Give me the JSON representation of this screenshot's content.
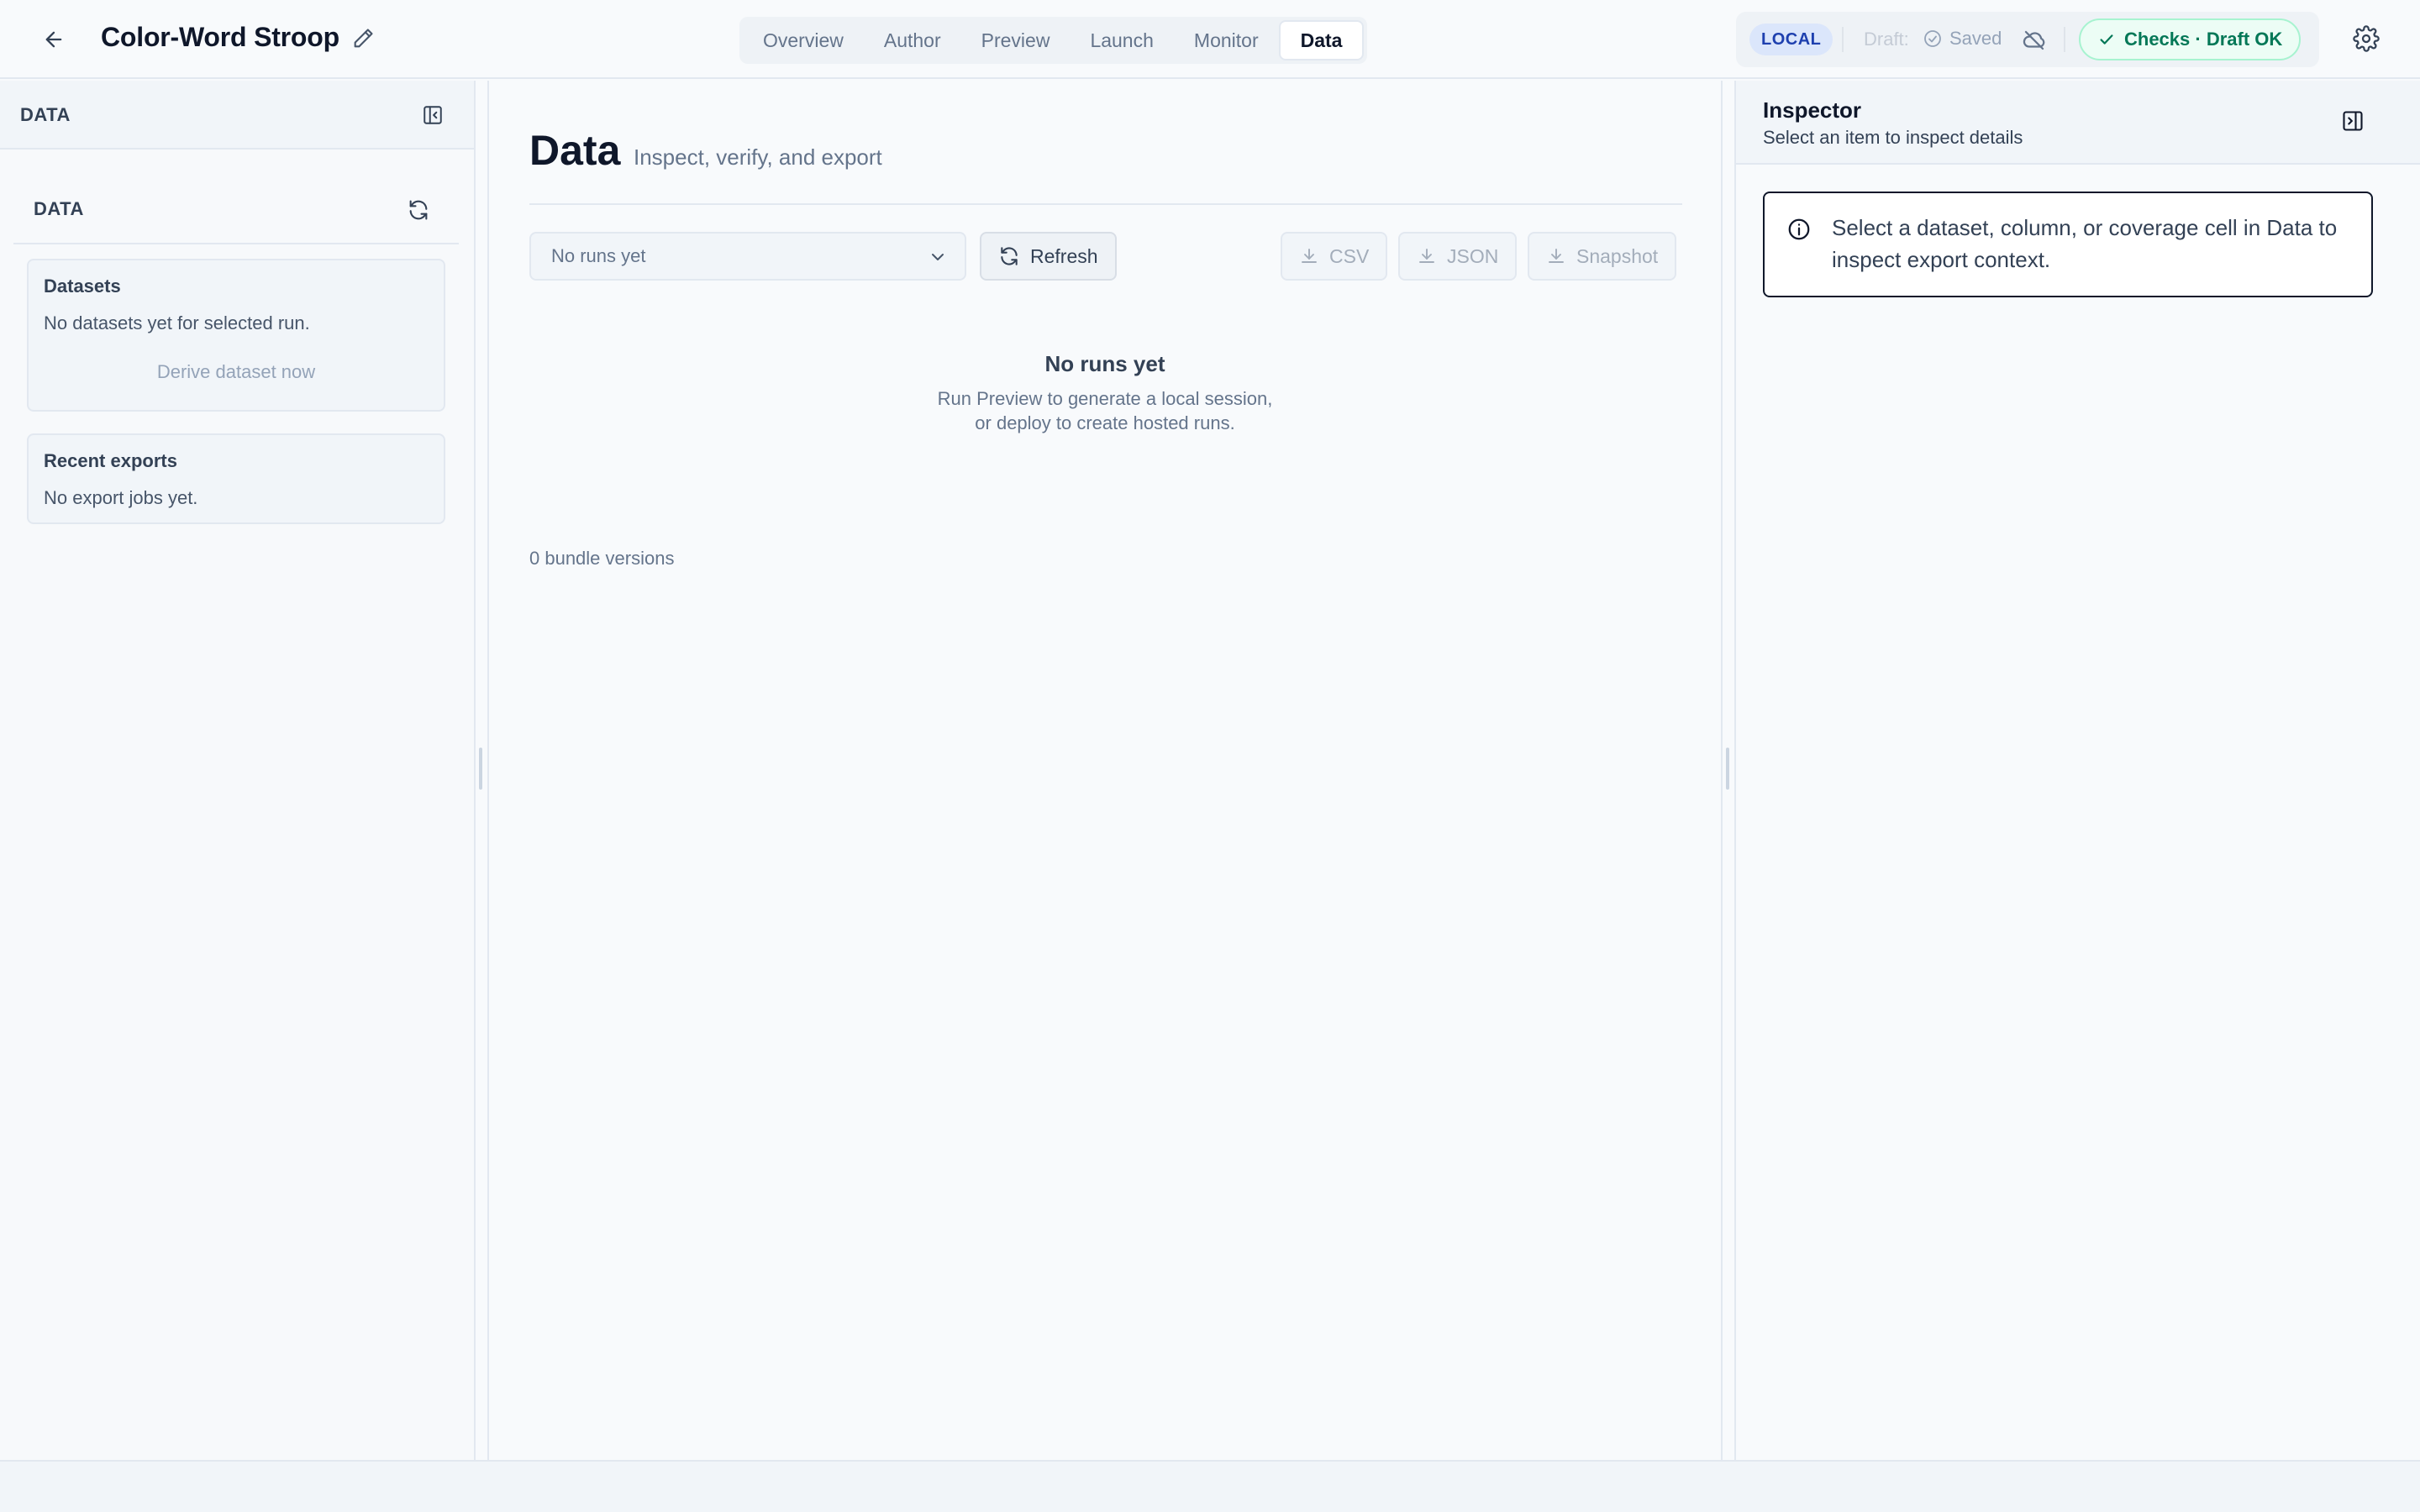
{
  "header": {
    "title": "Color-Word Stroop",
    "tabs": [
      {
        "label": "Overview"
      },
      {
        "label": "Author"
      },
      {
        "label": "Preview"
      },
      {
        "label": "Launch"
      },
      {
        "label": "Monitor"
      },
      {
        "label": "Data"
      }
    ],
    "active_tab": "Data",
    "env_badge": "LOCAL",
    "draft_label": "Draft:",
    "saved_label": "Saved",
    "checks_label": "Checks · Draft OK"
  },
  "sidebar": {
    "header_title": "DATA",
    "section_title": "DATA",
    "datasets": {
      "title": "Datasets",
      "empty_text": "No datasets yet for selected run.",
      "action_label": "Derive dataset now"
    },
    "exports": {
      "title": "Recent exports",
      "empty_text": "No export jobs yet."
    }
  },
  "main": {
    "title": "Data",
    "subtitle": "Inspect, verify, and export",
    "run_select": {
      "value": "No runs yet"
    },
    "refresh_label": "Refresh",
    "export_buttons": {
      "csv": "CSV",
      "json": "JSON",
      "snapshot": "Snapshot"
    },
    "empty_state": {
      "title": "No runs yet",
      "text": "Run Preview to generate a local session, or deploy to create hosted runs."
    },
    "bundle_versions": "0 bundle versions"
  },
  "inspector": {
    "title": "Inspector",
    "subtitle": "Select an item to inspect details",
    "info_text": "Select a dataset, column, or coverage cell in Data to inspect export context."
  },
  "icons": {
    "back": "arrow-left-icon",
    "edit": "pencil-icon",
    "saved": "check-circle-icon",
    "sync": "cloud-off-icon",
    "checks": "check-icon",
    "settings": "gear-icon",
    "collapse_left": "panel-left-collapse-icon",
    "refresh": "refresh-icon",
    "chevron": "chevron-down-icon",
    "download": "download-icon",
    "collapse_right": "panel-right-collapse-icon",
    "info": "info-icon"
  },
  "colors": {
    "accent_badge_bg": "#dbe6fb",
    "accent_badge_fg": "#1e40af",
    "success_fg": "#047857",
    "success_bg": "#ecfdf5"
  }
}
